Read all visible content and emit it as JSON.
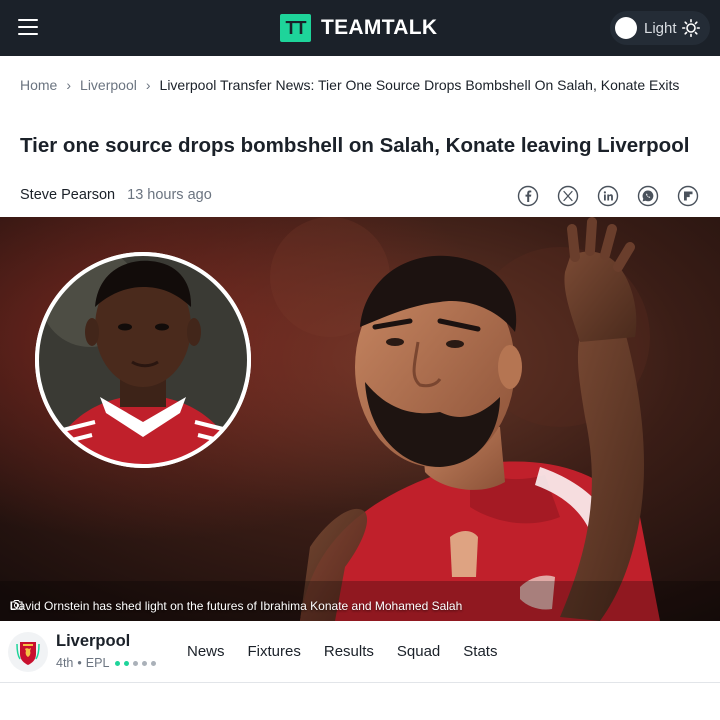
{
  "header": {
    "logo_mark": "TT",
    "logo_text": "TEAMTALK",
    "theme_label": "Light",
    "menu_icon": "hamburger-menu-icon",
    "theme_icon": "sun-icon",
    "colors": {
      "bar": "#1b2129",
      "brand": "#1ed49a"
    }
  },
  "breadcrumb": {
    "items": [
      "Home",
      "Liverpool"
    ],
    "current": "Liverpool Transfer News: Tier One Source Drops Bombshell On Salah, Konate Exits",
    "separator": "›"
  },
  "article": {
    "headline": "Tier one source drops bombshell on Salah, Konate leaving Liverpool",
    "author": "Steve Pearson",
    "published": "13 hours ago",
    "share_icons": [
      "facebook-icon",
      "x-icon",
      "linkedin-icon",
      "whatsapp-icon",
      "flipboard-icon"
    ],
    "image_caption": "David Ornstein has shed light on the futures of Ibrahima Konate and Mohamed Salah"
  },
  "club_bar": {
    "name": "Liverpool",
    "position": "4th",
    "league": "EPL",
    "meta_separator": "•",
    "form": [
      "win",
      "win",
      "loss",
      "loss",
      "loss"
    ],
    "nav": [
      "News",
      "Fixtures",
      "Results",
      "Squad",
      "Stats"
    ],
    "colors": {
      "win": "#1ed49a",
      "loss": "#aab1b9"
    }
  }
}
